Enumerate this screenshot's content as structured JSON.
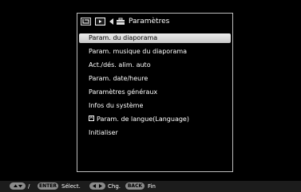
{
  "header": {
    "title": "Paramètres",
    "tabs": [
      {
        "icon": "crop-icon"
      },
      {
        "icon": "slideshow-icon"
      }
    ],
    "section_icon": "toolbox-icon"
  },
  "menu": {
    "selected_index": 0,
    "items": [
      {
        "label": "Param. du diaporama"
      },
      {
        "label": "Param. musique du diaporama"
      },
      {
        "label": "Act./dés. alim. auto"
      },
      {
        "label": "Param. date/heure"
      },
      {
        "label": "Paramètres généraux"
      },
      {
        "label": "Infos du système"
      },
      {
        "label": "Param. de langue(Language)",
        "icon_text": "A"
      },
      {
        "label": "Initialiser"
      }
    ]
  },
  "footer": {
    "slash": "/",
    "enter_key": "ENTER",
    "select_label": "Sélect.",
    "change_label": "Chg.",
    "back_key": "BACK",
    "end_label": "Fin"
  },
  "colors": {
    "background": "#000000",
    "panel_border": "#bdbdbd",
    "highlight": "#dcdcdc",
    "text": "#ffffff",
    "footer_bar": "#1c1c1c"
  }
}
